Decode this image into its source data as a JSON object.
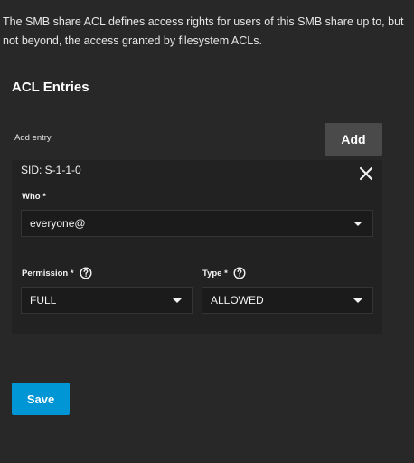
{
  "description": "The SMB share ACL defines access rights for users of this SMB share up to, but not beyond, the access granted by filesystem ACLs.",
  "section_title": "ACL Entries",
  "add_entry": {
    "label": "Add entry",
    "button_label": "Add"
  },
  "entry": {
    "sid_label": "SID: S-1-1-0",
    "who": {
      "label": "Who *",
      "value": "everyone@"
    },
    "permission": {
      "label": "Permission *",
      "value": "FULL"
    },
    "type": {
      "label": "Type *",
      "value": "ALLOWED"
    }
  },
  "save_label": "Save",
  "colors": {
    "background": "#282828",
    "card": "#222222",
    "primary": "#0095d5",
    "add_button": "#4a4a4a"
  },
  "icons": {
    "close": "close-icon",
    "help": "help-icon",
    "dropdown": "chevron-down-icon"
  }
}
